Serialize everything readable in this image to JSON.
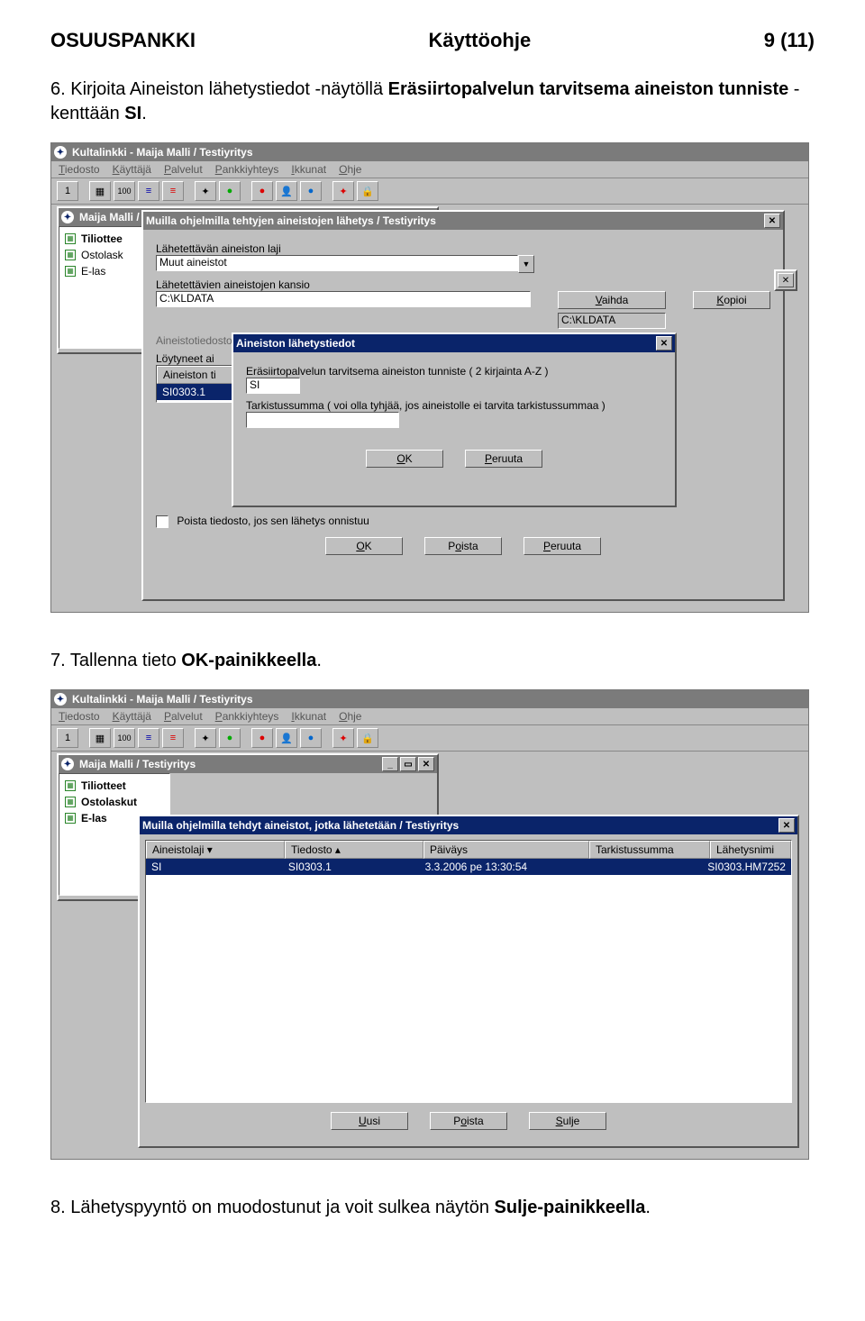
{
  "header": {
    "left": "OSUUSPANKKI",
    "center": "Käyttöohje",
    "right": "9 (11)"
  },
  "step6": {
    "prefix": "6. Kirjoita Aineiston lähetystiedot -näytöllä ",
    "bold1": "Eräsiirtopalvelun tarvitsema aineiston tunniste",
    "mid": " -kenttään ",
    "bold2": "SI",
    "suffix": "."
  },
  "step7": {
    "prefix": "7. Tallenna tieto ",
    "bold": "OK-painikkeella",
    "suffix": "."
  },
  "step8": {
    "prefix": "8. Lähetyspyyntö on muodostunut ja voit sulkea näytön ",
    "bold": "Sulje-painikkeella",
    "suffix": "."
  },
  "app": {
    "title": "Kultalinkki - Maija Malli / Testiyritys",
    "menus": [
      "Tiedosto",
      "Käyttäjä",
      "Palvelut",
      "Pankkiyhteys",
      "Ikkunat",
      "Ohje"
    ],
    "tb_first": "1"
  },
  "inner1": {
    "title": "Maija Malli /"
  },
  "tree1": {
    "items": [
      "Tiliottee",
      "Ostolask",
      "E-las"
    ]
  },
  "dlg_lahetys": {
    "title": "Muilla ohjelmilla tehtyjen aineistojen lähetys / Testiyritys",
    "l1": "Lähetettävän aineiston laji",
    "v1": "Muut aineistot",
    "l2": "Lähetettävien aineistojen kansio",
    "v2": "C:\\KLDATA",
    "btn_vaihda": "Vaihda",
    "btn_kopioi": "Kopioi",
    "readonly": "C:\\KLDATA",
    "l3": "Aineistotiedostojen nimien hakuehto ( tyhjä = kaikki tiedostot )",
    "l4": "Löytyneet ai",
    "listhead": "Aineiston ti",
    "listitem": "SI0303.1",
    "chk_label": "Poista tiedosto, jos sen lähetys onnistuu",
    "ok": "OK",
    "poista": "Poista",
    "peruuta": "Peruuta"
  },
  "dlg_tiedot": {
    "title": "Aineiston lähetystiedot",
    "l1": "Eräsiirtopalvelun tarvitsema aineiston tunniste ( 2 kirjainta A-Z )",
    "v1": "SI",
    "l2": "Tarkistussumma ( voi olla tyhjää, jos aineistolle ei tarvita tarkistussummaa )",
    "ok": "OK",
    "peruuta": "Peruuta"
  },
  "inner2": {
    "title": "Maija Malli / Testiyritys"
  },
  "tree2": {
    "items": [
      "Tiliotteet",
      "Ostolaskut",
      "E-las"
    ]
  },
  "dlg_list": {
    "title": "Muilla ohjelmilla tehdyt aineistot, jotka lähetetään / Testiyritys",
    "cols": [
      "Aineistolaji ▾",
      "Tiedosto ▴",
      "Päiväys",
      "Tarkistussumma",
      "Lähetysnimi"
    ],
    "row": [
      "SI",
      "SI0303.1",
      "3.3.2006 pe  13:30:54",
      "",
      "SI0303.HM7252"
    ],
    "uusi": "Uusi",
    "poista": "Poista",
    "sulje": "Sulje"
  }
}
